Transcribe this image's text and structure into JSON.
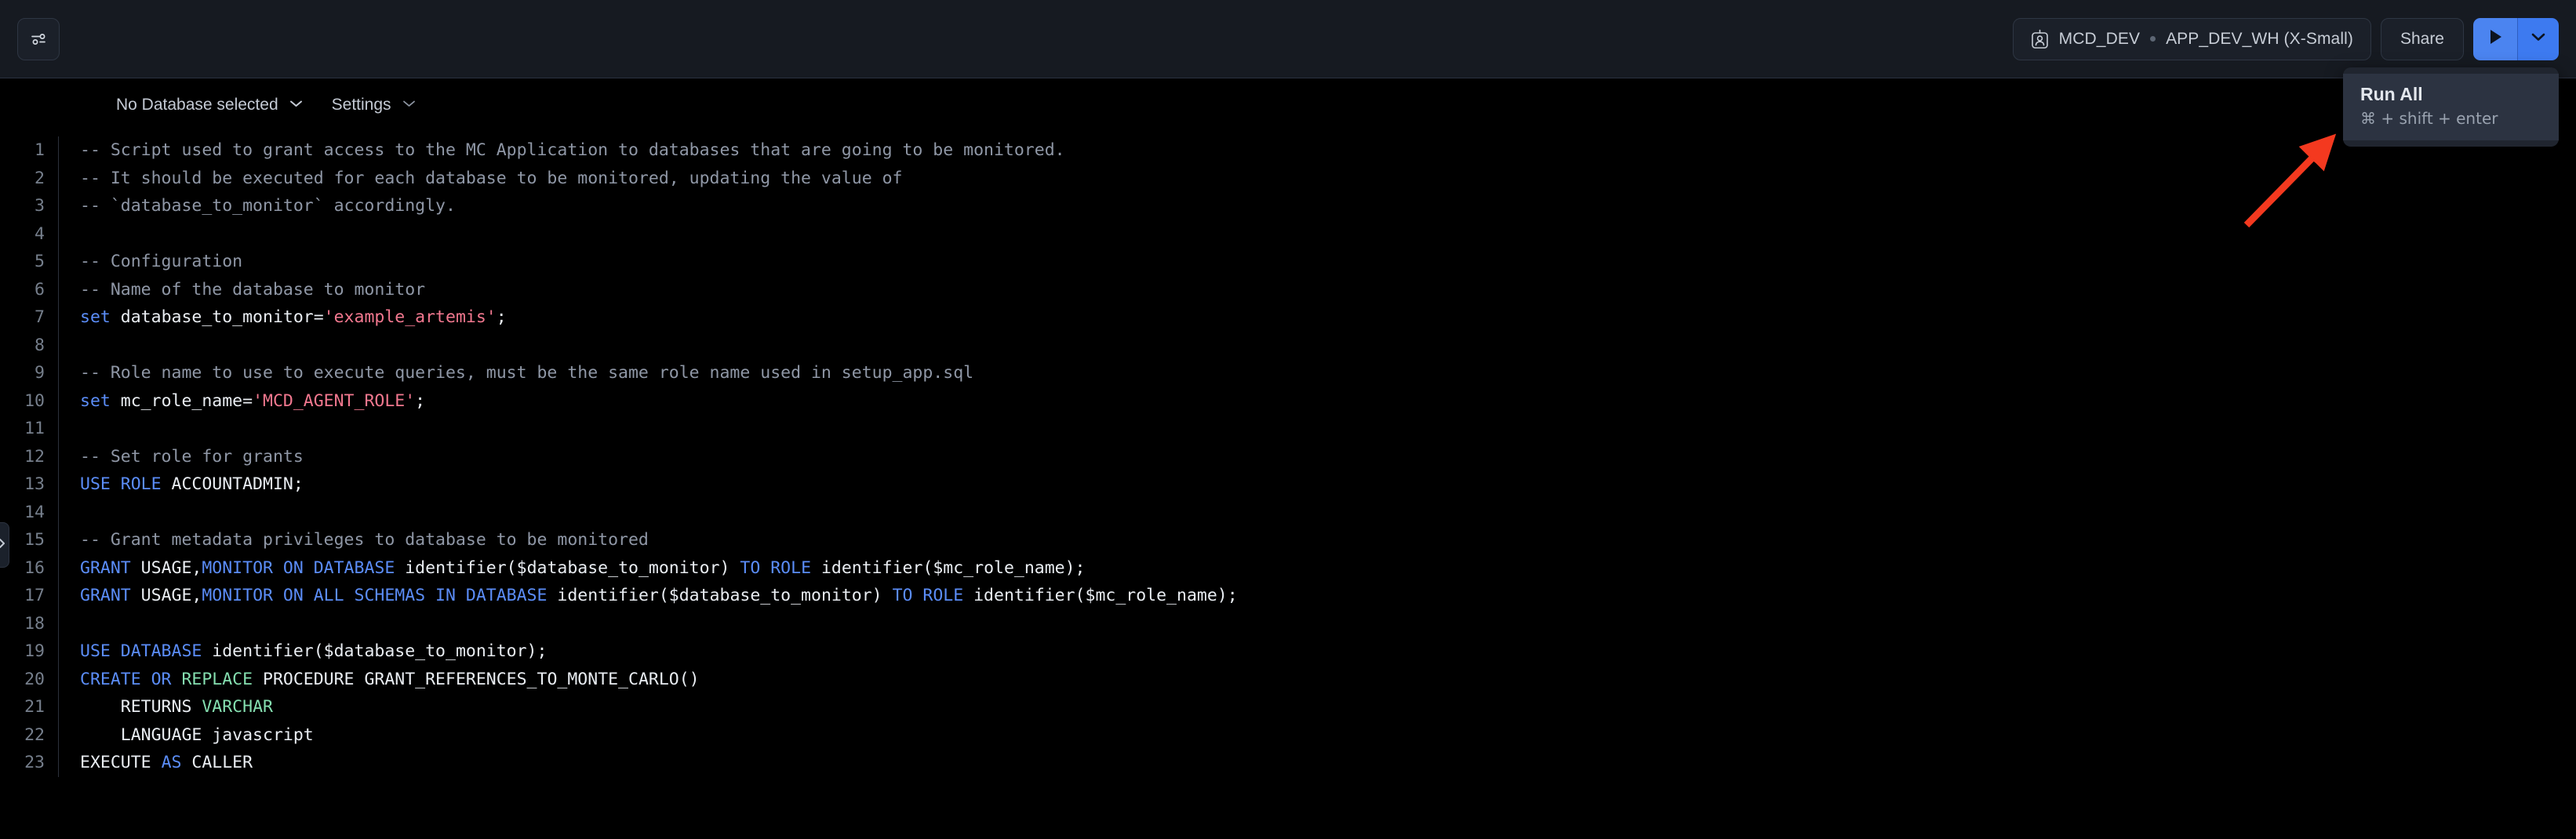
{
  "topbar": {
    "settings_button_icon": "sliders-icon",
    "context": {
      "badge_icon": "id-badge-icon",
      "role": "MCD_DEV",
      "separator": "•",
      "warehouse": "APP_DEV_WH (X-Small)"
    },
    "share_label": "Share",
    "run_icon": "play-icon",
    "run_caret_icon": "chevron-down-icon"
  },
  "run_menu": {
    "title": "Run All",
    "shortcut": "⌘ + shift + enter"
  },
  "subbar": {
    "database_label": "No Database selected",
    "database_caret_icon": "chevron-down-icon",
    "settings_label": "Settings",
    "settings_caret_icon": "chevron-down-icon"
  },
  "sidebar_handle": {
    "icon": "chevron-right-icon"
  },
  "editor": {
    "line_numbers": [
      1,
      2,
      3,
      4,
      5,
      6,
      7,
      8,
      9,
      10,
      11,
      12,
      13,
      14,
      15,
      16,
      17,
      18,
      19,
      20,
      21,
      22,
      23
    ],
    "lines": [
      {
        "n": 1,
        "tokens": [
          {
            "t": "-- Script used to grant access to the MC Application to databases that are going to be monitored.",
            "c": "c-cmt"
          }
        ]
      },
      {
        "n": 2,
        "tokens": [
          {
            "t": "-- It should be executed for each database to be monitored, updating the value of",
            "c": "c-cmt"
          }
        ]
      },
      {
        "n": 3,
        "tokens": [
          {
            "t": "-- `database_to_monitor` accordingly.",
            "c": "c-cmt"
          }
        ]
      },
      {
        "n": 4,
        "tokens": []
      },
      {
        "n": 5,
        "tokens": [
          {
            "t": "-- Configuration",
            "c": "c-cmt"
          }
        ]
      },
      {
        "n": 6,
        "tokens": [
          {
            "t": "-- Name of the database to monitor",
            "c": "c-cmt"
          }
        ]
      },
      {
        "n": 7,
        "tokens": [
          {
            "t": "set",
            "c": "c-kw"
          },
          {
            "t": " database_to_monitor=",
            "c": "c-txt"
          },
          {
            "t": "'example_artemis'",
            "c": "c-str"
          },
          {
            "t": ";",
            "c": "c-txt"
          }
        ]
      },
      {
        "n": 8,
        "tokens": []
      },
      {
        "n": 9,
        "tokens": [
          {
            "t": "-- Role name to use to execute queries, must be the same role name used in setup_app.sql",
            "c": "c-cmt"
          }
        ]
      },
      {
        "n": 10,
        "tokens": [
          {
            "t": "set",
            "c": "c-kw"
          },
          {
            "t": " mc_role_name=",
            "c": "c-txt"
          },
          {
            "t": "'MCD_AGENT_ROLE'",
            "c": "c-str"
          },
          {
            "t": ";",
            "c": "c-txt"
          }
        ]
      },
      {
        "n": 11,
        "tokens": []
      },
      {
        "n": 12,
        "tokens": [
          {
            "t": "-- Set role for grants",
            "c": "c-cmt"
          }
        ]
      },
      {
        "n": 13,
        "tokens": [
          {
            "t": "USE ROLE",
            "c": "c-kw"
          },
          {
            "t": " ACCOUNTADMIN;",
            "c": "c-txt"
          }
        ]
      },
      {
        "n": 14,
        "tokens": []
      },
      {
        "n": 15,
        "tokens": [
          {
            "t": "-- Grant metadata privileges to database to be monitored",
            "c": "c-cmt"
          }
        ]
      },
      {
        "n": 16,
        "tokens": [
          {
            "t": "GRANT",
            "c": "c-kw"
          },
          {
            "t": " USAGE,",
            "c": "c-txt"
          },
          {
            "t": "MONITOR ON DATABASE",
            "c": "c-kw"
          },
          {
            "t": " identifier($database_to_monitor) ",
            "c": "c-txt"
          },
          {
            "t": "TO ROLE",
            "c": "c-kw"
          },
          {
            "t": " identifier($mc_role_name);",
            "c": "c-txt"
          }
        ]
      },
      {
        "n": 17,
        "tokens": [
          {
            "t": "GRANT",
            "c": "c-kw"
          },
          {
            "t": " USAGE,",
            "c": "c-txt"
          },
          {
            "t": "MONITOR ON ALL SCHEMAS IN DATABASE",
            "c": "c-kw"
          },
          {
            "t": " identifier($database_to_monitor) ",
            "c": "c-txt"
          },
          {
            "t": "TO ROLE",
            "c": "c-kw"
          },
          {
            "t": " identifier($mc_role_name);",
            "c": "c-txt"
          }
        ]
      },
      {
        "n": 18,
        "tokens": []
      },
      {
        "n": 19,
        "tokens": [
          {
            "t": "USE DATABASE",
            "c": "c-kw"
          },
          {
            "t": " identifier($database_to_monitor);",
            "c": "c-txt"
          }
        ]
      },
      {
        "n": 20,
        "tokens": [
          {
            "t": "CREATE OR ",
            "c": "c-kw"
          },
          {
            "t": "REPLACE",
            "c": "c-kw2"
          },
          {
            "t": " PROCEDURE GRANT_REFERENCES_TO_MONTE_CARLO()",
            "c": "c-txt"
          }
        ]
      },
      {
        "n": 21,
        "tokens": [
          {
            "t": "    RETURNS ",
            "c": "c-txt"
          },
          {
            "t": "VARCHAR",
            "c": "c-kw2"
          }
        ]
      },
      {
        "n": 22,
        "tokens": [
          {
            "t": "    LANGUAGE javascript",
            "c": "c-txt"
          }
        ]
      },
      {
        "n": 23,
        "tokens": [
          {
            "t": "EXECUTE ",
            "c": "c-txt"
          },
          {
            "t": "AS",
            "c": "c-kw"
          },
          {
            "t": " CALLER",
            "c": "c-txt"
          }
        ]
      }
    ]
  },
  "colors": {
    "accent_blue": "#4b84f0",
    "annotation_red": "#f4391f",
    "topbar_bg": "#161a21",
    "editor_bg": "#000000",
    "menu_bg": "#2c3341",
    "comment": "#8f97a6",
    "keyword": "#5b8df8",
    "type": "#85dfb0",
    "string": "#f2788f"
  }
}
